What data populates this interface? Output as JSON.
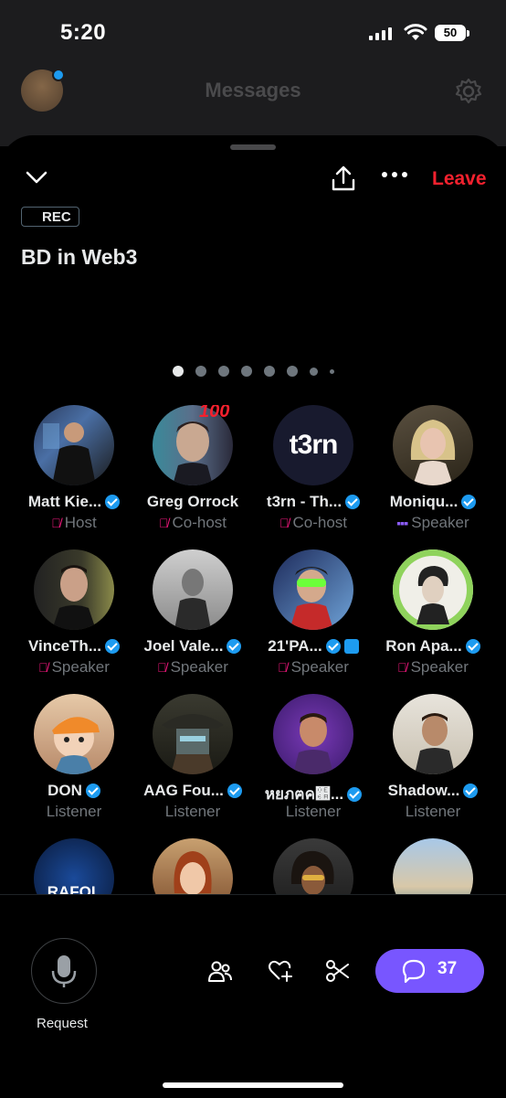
{
  "status_bar": {
    "time": "5:20",
    "battery": "50"
  },
  "header": {
    "title": "Messages"
  },
  "space": {
    "leave_label": "Leave",
    "rec_label": "REC",
    "title": "BD in Web3",
    "page_count": 8,
    "current_page": 1
  },
  "participants": [
    {
      "name": "Matt Kie...",
      "role": "Host",
      "verified": true,
      "muted": true
    },
    {
      "name": "Greg Orrock",
      "role": "Co-host",
      "verified": false,
      "muted": true
    },
    {
      "name": "t3rn - Th...",
      "role": "Co-host",
      "verified": true,
      "muted": true
    },
    {
      "name": "Moniqu...",
      "role": "Speaker",
      "verified": true,
      "speaking": true
    },
    {
      "name": "VinceTh...",
      "role": "Speaker",
      "verified": true,
      "muted": true
    },
    {
      "name": "Joel Vale...",
      "role": "Speaker",
      "verified": true,
      "muted": true
    },
    {
      "name": "21'PA...",
      "role": "Speaker",
      "verified": true,
      "muted": true
    },
    {
      "name": "Ron Apa...",
      "role": "Speaker",
      "verified": true,
      "muted": true
    },
    {
      "name": "DON",
      "role": "Listener",
      "verified": true
    },
    {
      "name": "AAG Fou...",
      "role": "Listener",
      "verified": true
    },
    {
      "name": "หยภฅค๪...",
      "role": "Listener",
      "verified": true
    },
    {
      "name": "Shadow...",
      "role": "Listener",
      "verified": true
    }
  ],
  "avatar_texts": {
    "t3rn": "t3rn",
    "badge100": "100",
    "rafol": "RAFOL"
  },
  "bottom": {
    "request_label": "Request",
    "chat_count": "37"
  },
  "colors": {
    "leave": "#f4212e",
    "verified": "#1d9bf0",
    "accent": "#7856ff",
    "muted": "#f91880"
  }
}
